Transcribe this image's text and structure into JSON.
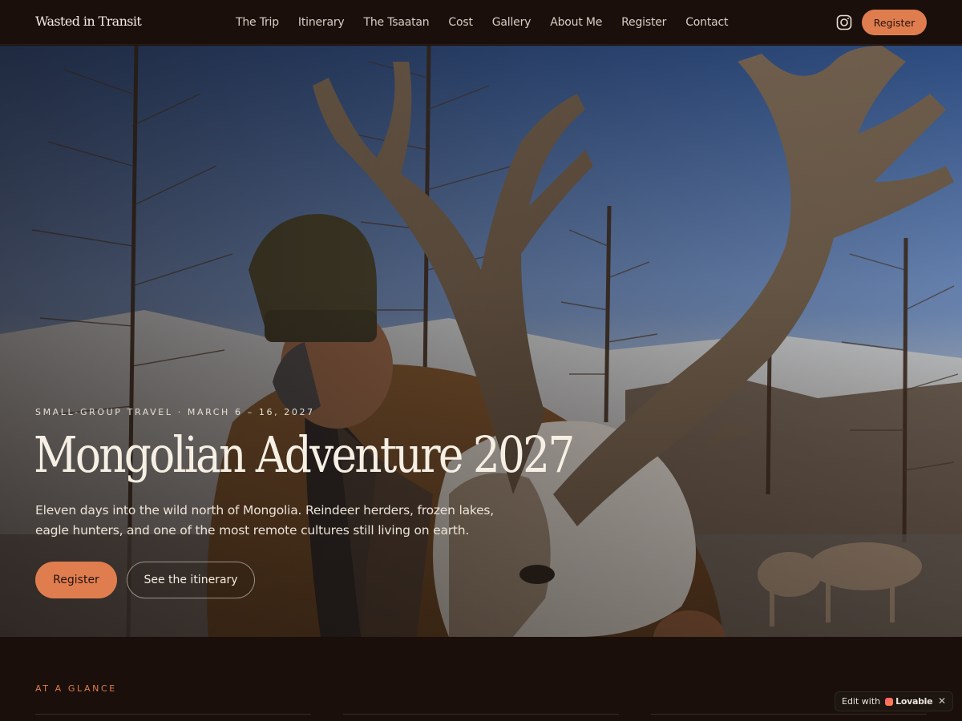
{
  "brand": {
    "logo_text": "Wasted in Transit"
  },
  "nav": {
    "items": [
      {
        "label": "The Trip"
      },
      {
        "label": "Itinerary"
      },
      {
        "label": "The Tsaatan"
      },
      {
        "label": "Cost"
      },
      {
        "label": "Gallery"
      },
      {
        "label": "About Me"
      },
      {
        "label": "Register"
      },
      {
        "label": "Contact"
      }
    ],
    "social_icon": "instagram-icon",
    "register_label": "Register"
  },
  "hero": {
    "eyebrow": "SMALL-GROUP TRAVEL · MARCH 6 – 16, 2027",
    "title": "Mongolian Adventure 2027",
    "lede_line1": "Eleven days into the wild north of Mongolia. Reindeer herders, frozen lakes,",
    "lede_line2": "eagle hunters, and one of the most remote cultures still living on earth.",
    "primary_cta": "Register",
    "secondary_cta": "See the itinerary"
  },
  "glance": {
    "label": "AT A GLANCE"
  },
  "edit_badge": {
    "prefix": "Edit with",
    "brand": "Lovable",
    "close": "✕"
  },
  "colors": {
    "accent": "#e07d4f",
    "background": "#1a0f0a",
    "text": "#f3ece2"
  }
}
